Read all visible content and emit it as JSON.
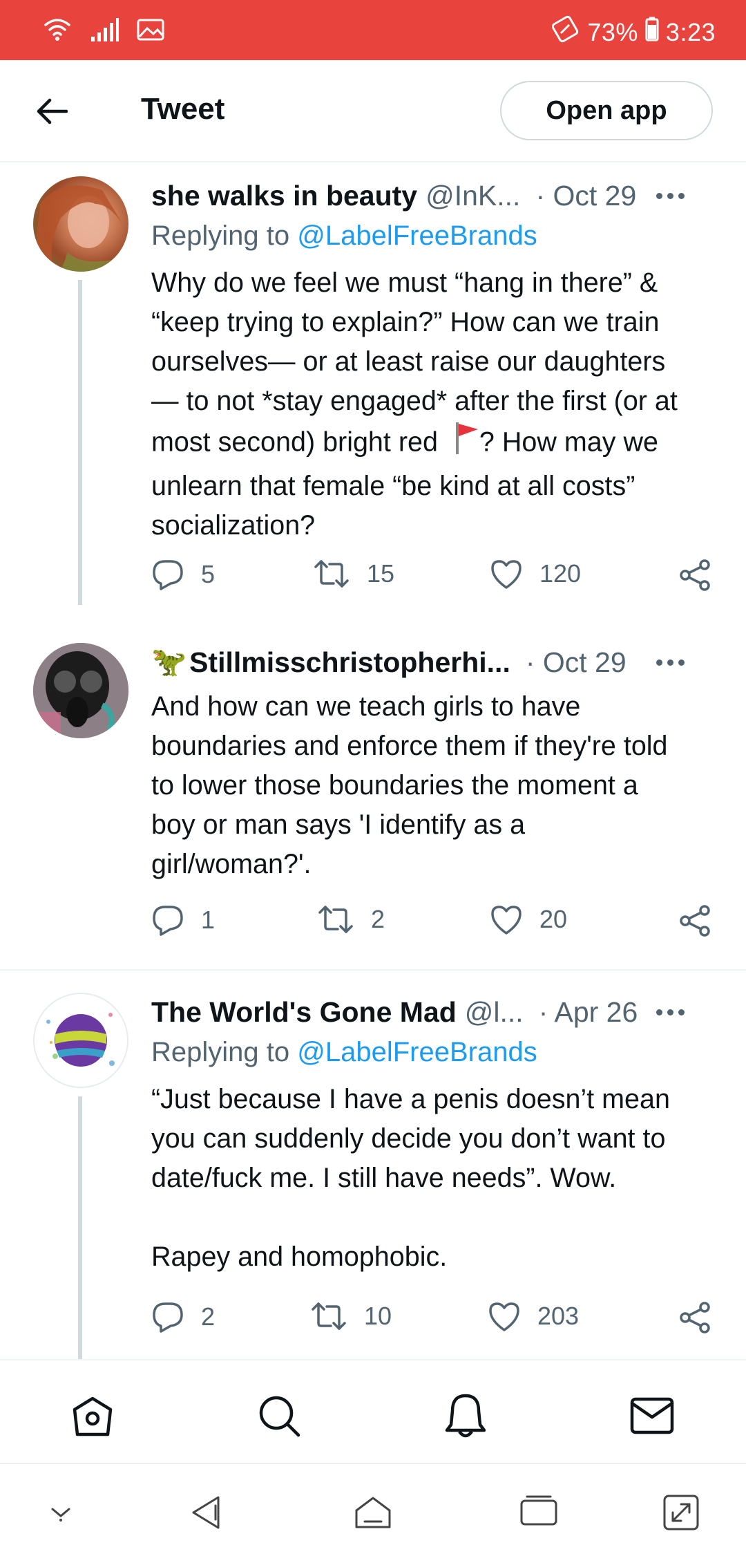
{
  "status_bar": {
    "battery": "73%",
    "time": "3:23"
  },
  "header": {
    "title": "Tweet",
    "open_app_label": "Open app"
  },
  "tweets": [
    {
      "name": "she walks in beauty",
      "handle": "@InK...",
      "date": "· Oct 29",
      "replying_prefix": "Replying to",
      "replying_to": "@LabelFreeBrands",
      "body_lines": [
        "Why do we feel we must “hang in there” &",
        "“keep trying to explain?” How can we train",
        "ourselves— or at least raise our daughters",
        "— to not *stay engaged* after the first (or at",
        "most second) bright red",
        "? How may we",
        "unlearn that female “be kind at all costs”",
        "socialization?"
      ],
      "replies": "5",
      "retweets": "15",
      "likes": "120"
    },
    {
      "name_emoji": "🦖",
      "name": "Stillmisschristopherhi...",
      "date": "· Oct 29",
      "body_lines": [
        "And how can we teach girls to have",
        "boundaries and enforce them if they're told",
        "to lower those boundaries the moment a",
        "boy or man says 'I identify as a",
        "girl/woman?'."
      ],
      "replies": "1",
      "retweets": "2",
      "likes": "20"
    },
    {
      "name": "The World's Gone Mad",
      "handle": "@l...",
      "date": "· Apr 26",
      "replying_prefix": "Replying to",
      "replying_to": "@LabelFreeBrands",
      "body_lines": [
        "“Just because I have a penis doesn’t mean",
        "you can suddenly decide you don’t want to",
        "date/fuck me. I still have needs”. Wow.",
        "",
        "Rapey and homophobic."
      ],
      "replies": "2",
      "retweets": "10",
      "likes": "203"
    }
  ],
  "bottom_nav": [
    "home-icon",
    "search-icon",
    "notifications-icon",
    "messages-icon"
  ],
  "colors": {
    "status_bar": "#e8433c",
    "mention": "#1d9bf0",
    "secondary_text": "#536471"
  }
}
